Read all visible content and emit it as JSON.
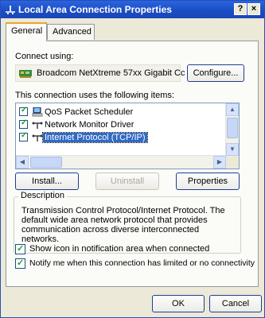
{
  "window": {
    "title": "Local Area Connection Properties",
    "help_button": "?",
    "close_button": "×"
  },
  "tabs": [
    {
      "label": "General"
    },
    {
      "label": "Advanced"
    }
  ],
  "general": {
    "connect_using_label": "Connect using:",
    "adapter_name": "Broadcom NetXtreme 57xx Gigabit Cc",
    "configure_button": "Configure...",
    "items_label": "This connection uses the following items:",
    "items": [
      {
        "label": "QoS Packet Scheduler",
        "checked": true
      },
      {
        "label": "Network Monitor Driver",
        "checked": true
      },
      {
        "label": "Internet Protocol (TCP/IP)",
        "checked": true,
        "selected": true
      }
    ],
    "install_button": "Install...",
    "uninstall_button": "Uninstall",
    "properties_button": "Properties",
    "description_label": "Description",
    "description_text": "Transmission Control Protocol/Internet Protocol. The default wide area network protocol that provides communication across diverse interconnected networks.",
    "show_icon_label": "Show icon in notification area when connected",
    "show_icon_checked": true,
    "notify_label": "Notify me when this connection has limited or no connectivity",
    "notify_checked": true
  },
  "footer": {
    "ok_button": "OK",
    "cancel_button": "Cancel"
  },
  "colors": {
    "titlebar": "#1b4ec4",
    "selection": "#316ac5",
    "tab_highlight": "#f0a22c"
  }
}
